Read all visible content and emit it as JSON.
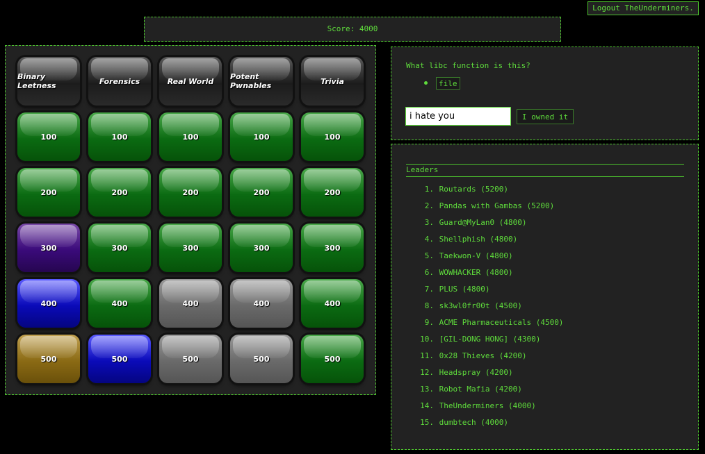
{
  "logout_label": "Logout TheUnderminers.",
  "score_label": "Score: 4000",
  "board": {
    "categories": [
      "Binary Leetness",
      "Forensics",
      "Real World",
      "Potent Pwnables",
      "Trivia"
    ],
    "rows": [
      {
        "value": "100",
        "states": [
          "green",
          "green",
          "green",
          "green",
          "green"
        ]
      },
      {
        "value": "200",
        "states": [
          "green",
          "green",
          "green",
          "green",
          "green"
        ]
      },
      {
        "value": "300",
        "states": [
          "purple",
          "green",
          "green",
          "green",
          "green"
        ]
      },
      {
        "value": "400",
        "states": [
          "blue",
          "green",
          "gray",
          "gray",
          "green"
        ]
      },
      {
        "value": "500",
        "states": [
          "gold",
          "blue",
          "gray",
          "gray",
          "green"
        ]
      }
    ],
    "colors": {
      "green": "#0b6b12",
      "purple": "#3a0a7a",
      "blue": "#0a0ab8",
      "gray": "#6a6a6a",
      "gold": "#8a6a14",
      "header": "#1c1c1c"
    }
  },
  "question": {
    "prompt": "What libc function is this?",
    "hint": "file",
    "answer_value": "i hate you",
    "submit_label": "I owned it"
  },
  "leaders": {
    "title": "Leaders",
    "entries": [
      {
        "rank": "1.",
        "text": "Routards (5200)"
      },
      {
        "rank": "2.",
        "text": "Pandas with Gambas (5200)"
      },
      {
        "rank": "3.",
        "text": "Guard@MyLan0 (4800)"
      },
      {
        "rank": "4.",
        "text": "Shellphish (4800)"
      },
      {
        "rank": "5.",
        "text": "Taekwon-V (4800)"
      },
      {
        "rank": "6.",
        "text": "WOWHACKER (4800)"
      },
      {
        "rank": "7.",
        "text": "PLUS (4800)"
      },
      {
        "rank": "8.",
        "text": "sk3wl0fr00t (4500)"
      },
      {
        "rank": "9.",
        "text": "ACME Pharmaceuticals (4500)"
      },
      {
        "rank": "10.",
        "text": "[GIL-DONG HONG] (4300)"
      },
      {
        "rank": "11.",
        "text": "0x28 Thieves (4200)"
      },
      {
        "rank": "12.",
        "text": "Headspray (4200)"
      },
      {
        "rank": "13.",
        "text": "Robot Mafia (4200)"
      },
      {
        "rank": "14.",
        "text": "TheUnderminers (4000)"
      },
      {
        "rank": "15.",
        "text": "dumbtech (4000)"
      }
    ]
  },
  "text_color": "#5fdc3c",
  "border_color": "#4ec82e"
}
